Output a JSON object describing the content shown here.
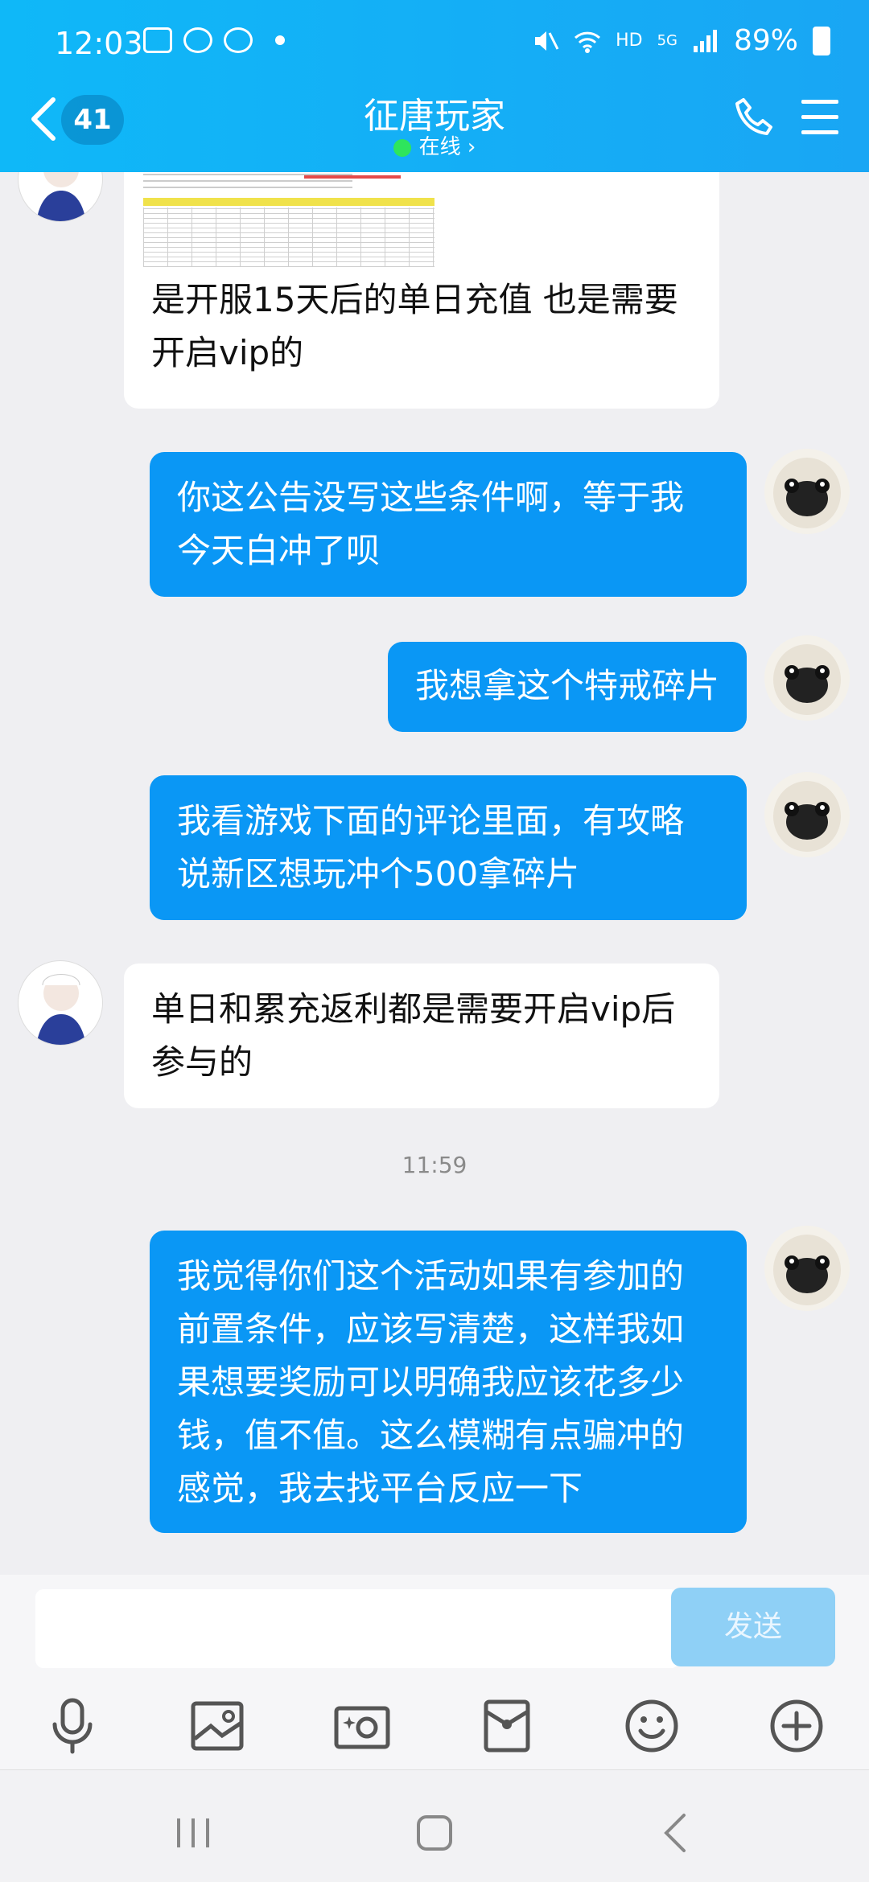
{
  "status_bar": {
    "time": "12:03",
    "network": "HD",
    "signal": "5G",
    "battery": "89%"
  },
  "header": {
    "unread_badge": "41",
    "title": "征唐玩家",
    "status": "在线 ›"
  },
  "messages": [
    {
      "side": "in",
      "text_lines": [
        "是开服15天后的单日充值 也是需要",
        "开启vip的"
      ],
      "has_image": true
    },
    {
      "side": "out",
      "text_lines": [
        "你这公告没写这些条件啊，等于我",
        "今天白冲了呗"
      ]
    },
    {
      "side": "out",
      "text_lines": [
        "我想拿这个特戒碎片"
      ]
    },
    {
      "side": "out",
      "text_lines": [
        "我看游戏下面的评论里面，有攻略",
        "说新区想玩冲个500拿碎片"
      ]
    },
    {
      "side": "in",
      "text_lines": [
        "单日和累充返利都是需要开启vip后",
        "参与的"
      ]
    },
    {
      "timestamp": "11:59"
    },
    {
      "side": "out",
      "text_lines": [
        "我觉得你们这个活动如果有参加的",
        "前置条件，应该写清楚，这样我如",
        "果想要奖励可以明确我应该花多少",
        "钱，值不值。这么模糊有点骗冲的",
        "感觉，我去找平台反应一下"
      ]
    }
  ],
  "input": {
    "send_label": "发送"
  },
  "toolbar_icons": [
    "microphone-icon",
    "image-icon",
    "camera-icon",
    "red-packet-icon",
    "emoji-icon",
    "plus-icon"
  ],
  "nav_icons": [
    "recent-apps-icon",
    "home-icon",
    "back-icon"
  ]
}
